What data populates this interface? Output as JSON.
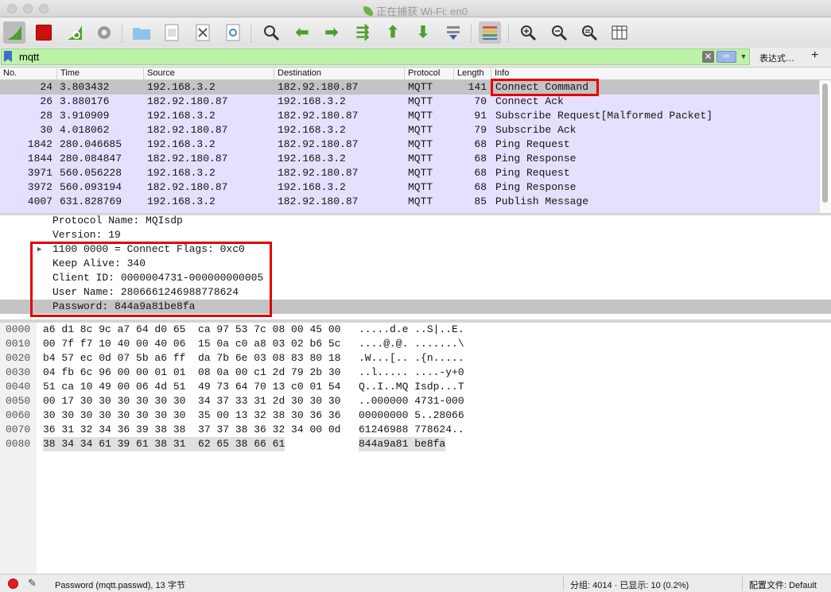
{
  "window": {
    "title": "正在捕获 Wi-Fi: en0"
  },
  "toolbar": {
    "icons": [
      "shark-fin-start-icon",
      "stop-capture-icon",
      "restart-capture-icon",
      "capture-options-gear-icon",
      "open-file-folder-icon",
      "save-file-icon",
      "close-file-icon",
      "reload-file-icon",
      "find-packet-icon",
      "go-back-arrow-icon",
      "go-forward-arrow-icon",
      "go-to-packet-icon",
      "first-packet-icon",
      "last-packet-icon",
      "autoscroll-icon",
      "colorize-icon",
      "zoom-in-icon",
      "zoom-out-icon",
      "zoom-normal-icon",
      "resize-columns-icon"
    ]
  },
  "filter": {
    "value": "mqtt",
    "expression_label": "表达式…",
    "add_label": "+"
  },
  "packet_list": {
    "headers": [
      "No.",
      "Time",
      "Source",
      "Destination",
      "Protocol",
      "Length",
      "Info"
    ],
    "rows": [
      [
        "24",
        "3.803432",
        "192.168.3.2",
        "182.92.180.87",
        "MQTT",
        "141",
        "Connect Command"
      ],
      [
        "26",
        "3.880176",
        "182.92.180.87",
        "192.168.3.2",
        "MQTT",
        "70",
        "Connect Ack"
      ],
      [
        "28",
        "3.910909",
        "192.168.3.2",
        "182.92.180.87",
        "MQTT",
        "91",
        "Subscribe Request[Malformed Packet]"
      ],
      [
        "30",
        "4.018062",
        "182.92.180.87",
        "192.168.3.2",
        "MQTT",
        "79",
        "Subscribe Ack"
      ],
      [
        "1842",
        "280.046685",
        "192.168.3.2",
        "182.92.180.87",
        "MQTT",
        "68",
        "Ping Request"
      ],
      [
        "1844",
        "280.084847",
        "182.92.180.87",
        "192.168.3.2",
        "MQTT",
        "68",
        "Ping Response"
      ],
      [
        "3971",
        "560.056228",
        "192.168.3.2",
        "182.92.180.87",
        "MQTT",
        "68",
        "Ping Request"
      ],
      [
        "3972",
        "560.093194",
        "182.92.180.87",
        "192.168.3.2",
        "MQTT",
        "68",
        "Ping Response"
      ],
      [
        "4007",
        "631.828769",
        "192.168.3.2",
        "182.92.180.87",
        "MQTT",
        "85",
        "Publish Message"
      ]
    ],
    "selected_index": 0,
    "row_color": "#e4e0fd",
    "selected_color": "#c3c3c3"
  },
  "details": {
    "lines": [
      "Protocol Name: MQIsdp",
      "Version: 19",
      "1100 0000 = Connect Flags: 0xc0",
      "Keep Alive: 340",
      "Client ID: 0000004731-000000000005",
      "User Name: 2806661246988778624",
      "Password: 844a9a81be8fa"
    ],
    "expandable_index": 2,
    "selected_index": 6
  },
  "bytes": {
    "rows": [
      {
        "offset": "0000",
        "hex": "a6 d1 8c 9c a7 64 d0 65  ca 97 53 7c 08 00 45 00",
        "ascii": ".....d.e ..S|..E."
      },
      {
        "offset": "0010",
        "hex": "00 7f f7 10 40 00 40 06  15 0a c0 a8 03 02 b6 5c",
        "ascii": "....@.@. .......\\"
      },
      {
        "offset": "0020",
        "hex": "b4 57 ec 0d 07 5b a6 ff  da 7b 6e 03 08 83 80 18",
        "ascii": ".W...[.. .{n....."
      },
      {
        "offset": "0030",
        "hex": "04 fb 6c 96 00 00 01 01  08 0a 00 c1 2d 79 2b 30",
        "ascii": "..l..... ....-y+0"
      },
      {
        "offset": "0040",
        "hex": "51 ca 10 49 00 06 4d 51  49 73 64 70 13 c0 01 54",
        "ascii": "Q..I..MQ Isdp...T"
      },
      {
        "offset": "0050",
        "hex": "00 17 30 30 30 30 30 30  34 37 33 31 2d 30 30 30",
        "ascii": "..000000 4731-000"
      },
      {
        "offset": "0060",
        "hex": "30 30 30 30 30 30 30 30  35 00 13 32 38 30 36 36",
        "ascii": "00000000 5..28066"
      },
      {
        "offset": "0070",
        "hex": "36 31 32 34 36 39 38 38  37 37 38 36 32 34 00 0d",
        "ascii": "61246988 778624.."
      },
      {
        "offset": "0080",
        "hex": "38 34 34 61 39 61 38 31  62 65 38 66 61",
        "ascii": "844a9a81 be8fa"
      }
    ]
  },
  "status": {
    "field_info": "Password (mqtt.passwd), 13 字节",
    "stats": "分组: 4014 · 已显示: 10 (0.2%)",
    "profile": "配置文件: Default"
  }
}
